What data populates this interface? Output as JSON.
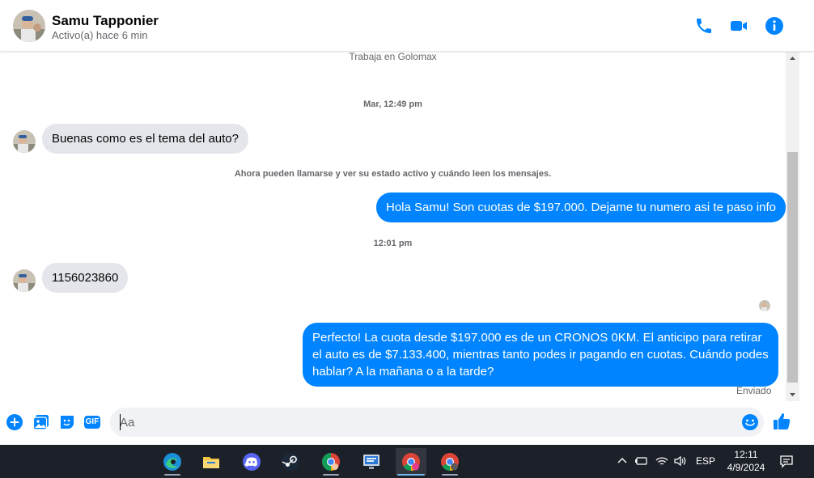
{
  "header": {
    "name": "Samu Tapponier",
    "status": "Activo(a) hace 6 min",
    "colors": {
      "accent": "#0084ff"
    }
  },
  "conversation": {
    "work_line": "Trabaja en Golomax",
    "timestamp1": "Mar, 12:49 pm",
    "msg1": "Buenas como es el tema del auto?",
    "notice": "Ahora pueden llamarse y ver su estado activo y cuándo leen los mensajes.",
    "msg2": "Hola Samu! Son cuotas de $197.000. Dejame tu numero asi te paso info",
    "timestamp2": "12:01 pm",
    "msg3": "1156023860",
    "msg4": "Perfecto! La cuota desde $197.000 es de un CRONOS 0KM. El anticipo para retirar el auto es de $7.133.400, mientras tanto podes ir pagando en cuotas. Cuándo podes hablar? A la mañana o a la tarde?",
    "sent_label": "Enviado"
  },
  "composer": {
    "placeholder": "Aa",
    "gif_label": "GIF"
  },
  "taskbar": {
    "apps": [
      "edge-icon",
      "file-explorer-icon",
      "discord-icon",
      "steam-icon",
      "chrome-icon",
      "network-monitor-icon",
      "chrome-icon",
      "chrome-icon"
    ],
    "language": "ESP",
    "time": "12:11",
    "date": "4/9/2024"
  }
}
